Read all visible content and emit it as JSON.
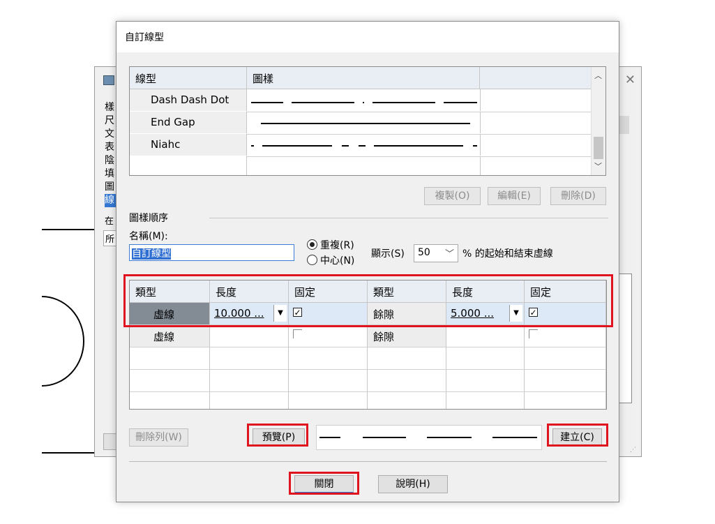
{
  "dialog": {
    "title": "自訂線型",
    "linetype_table": {
      "headers": [
        "線型",
        "圖樣",
        ""
      ],
      "rows": [
        {
          "name": "Dash Dash Dot",
          "pattern_icon": "dash-dash-dot-pattern"
        },
        {
          "name": "End Gap",
          "pattern_icon": "solid-with-end-gap-pattern"
        },
        {
          "name": "Niahc",
          "pattern_icon": "long-dash-short-pattern"
        }
      ]
    },
    "table_buttons": {
      "copy": "複製(O)",
      "edit": "編輯(E)",
      "delete": "刪除(D)"
    },
    "pattern_section": {
      "group_label": "圖樣順序",
      "name_label": "名稱(M):",
      "name_value": "自訂線型",
      "radio_repeat": "重複(R)",
      "radio_center": "中心(N)",
      "display_label": "顯示(S)",
      "display_value": "50",
      "display_suffix": "% 的起始和結束虛線"
    },
    "segment_table": {
      "headers": [
        "類型",
        "長度",
        "固定",
        "類型",
        "長度",
        "固定"
      ],
      "rows": [
        {
          "type1": "虛線",
          "length1": "10.000 ...",
          "fixed1": true,
          "type2": "餘隙",
          "length2": "5.000 ...",
          "fixed2": true
        },
        {
          "type1": "虛線",
          "length1": "",
          "fixed1": false,
          "type2": "餘隙",
          "length2": "",
          "fixed2": false
        }
      ]
    },
    "buttons": {
      "delete_row": "刪除列(W)",
      "preview": "預覽(P)",
      "create": "建立(C)",
      "close": "關閉",
      "help": "說明(H)"
    },
    "check_mark": "✓"
  },
  "background_dialog": {
    "side_chars": [
      "樣",
      "尺",
      "文",
      "表",
      "陰",
      "填",
      "圖",
      "線"
    ],
    "label_at": "在",
    "label_all": "所"
  },
  "colors": {
    "highlight": "#e0141e",
    "selection": "#2f6fd1",
    "header_bg": "#e9eef5"
  }
}
